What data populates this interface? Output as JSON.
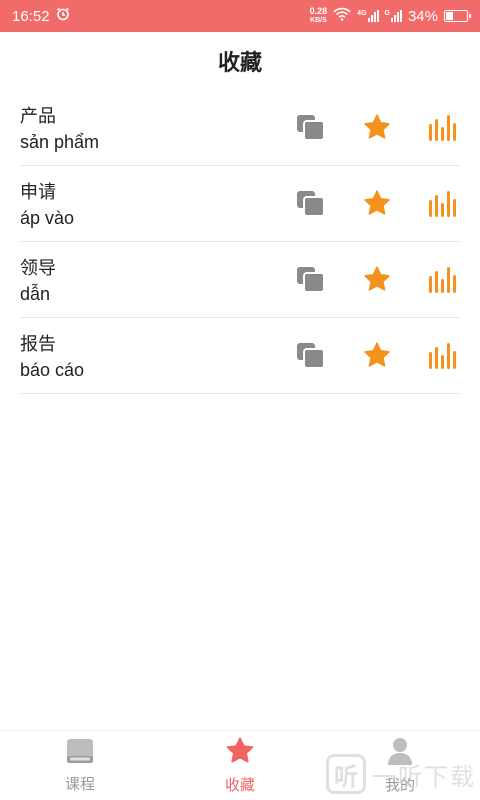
{
  "status_bar": {
    "time": "16:52",
    "net_speed_value": "0.28",
    "net_speed_unit": "KB/S",
    "signal1_label": "4G",
    "signal2_label": "G",
    "battery": "34%",
    "battery_level": 0.34
  },
  "header": {
    "title": "收藏"
  },
  "favorites": [
    {
      "zh": "产品",
      "vi": "sản phẩm"
    },
    {
      "zh": "申请",
      "vi": "áp vào"
    },
    {
      "zh": "领导",
      "vi": "dẫn"
    },
    {
      "zh": "报告",
      "vi": "báo cáo"
    }
  ],
  "icons": {
    "copy": "copy-icon",
    "star": "star-icon",
    "audio": "audio-bars-icon"
  },
  "colors": {
    "status_bar": "#f26b6b",
    "accent_orange": "#f5921e",
    "icon_gray": "#8a8a8a",
    "nav_active": "#f06464",
    "nav_inactive": "#9a9a9a"
  },
  "bottom_nav": [
    {
      "label": "课程",
      "active": false
    },
    {
      "label": "收藏",
      "active": true
    },
    {
      "label": "我的",
      "active": false
    }
  ],
  "watermark": {
    "badge": "听",
    "text": "一听下载"
  }
}
